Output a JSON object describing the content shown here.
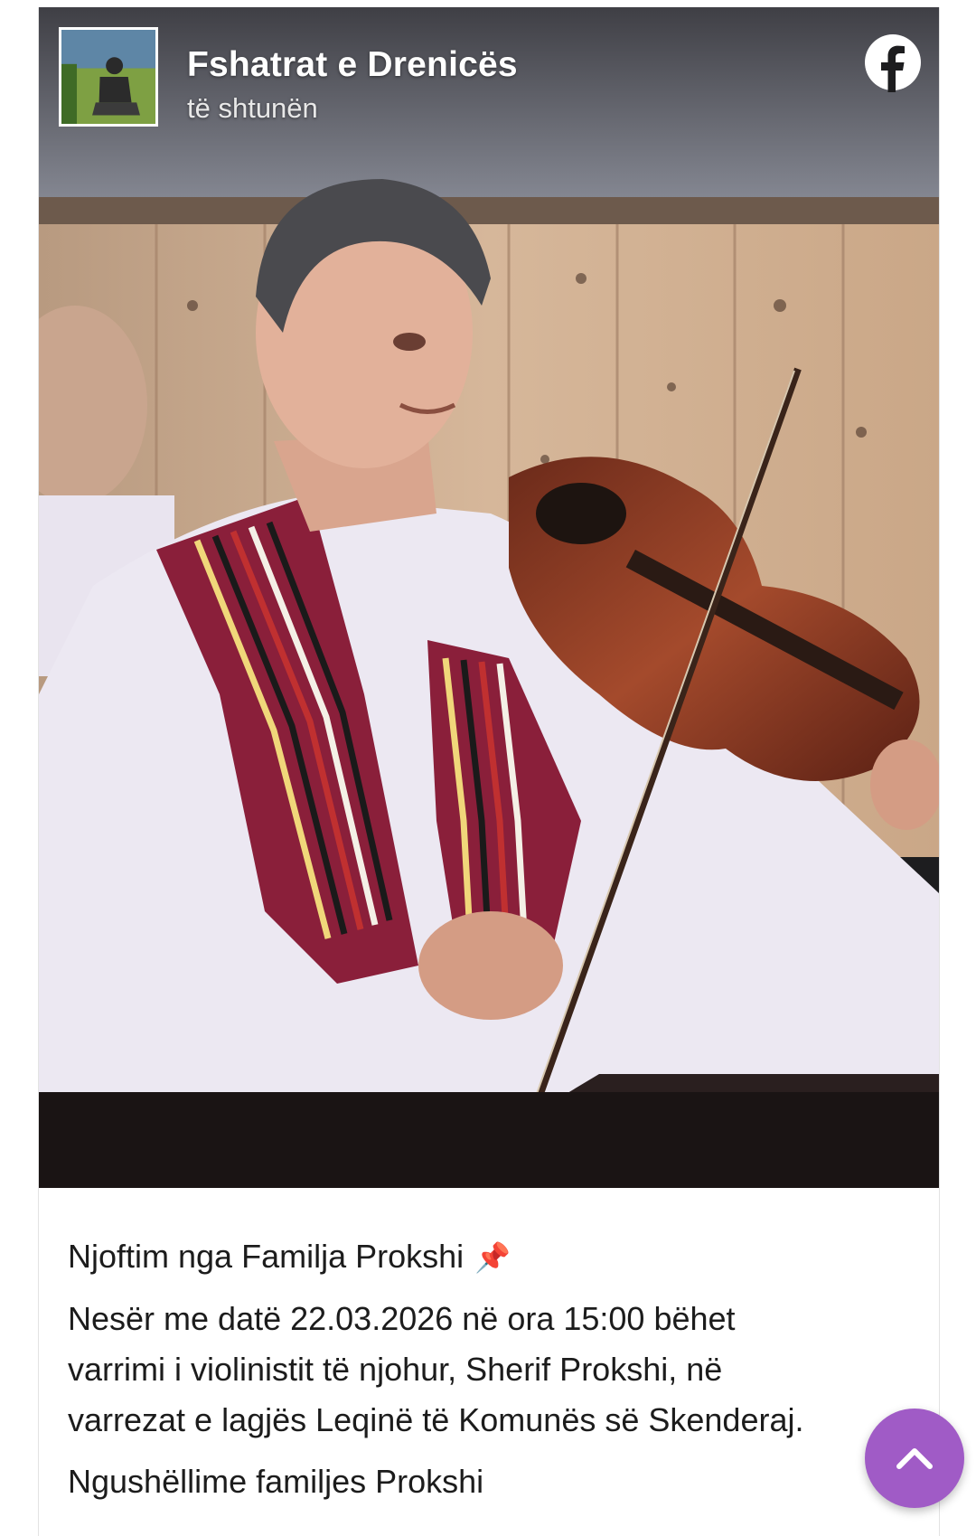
{
  "post": {
    "page_name": "Fshatrat e Drenicës",
    "time": "të shtunën",
    "avatar_icon": "page-avatar",
    "brand_icon": "facebook-logo-icon",
    "photo_subject": "",
    "announcement_title": "Njoftim nga Familja Prokshi",
    "pin_emoji": "📌",
    "body_lines": [
      "Nesër me datë 22.03.2026 në ora 15:00 bëhet",
      "varrimi i violinistit të njohur, Sherif Prokshi, në",
      "varrezat e lagjës Leqinë të Komunës së Skenderaj."
    ],
    "condolence": "Ngushëllime familjes Prokshi"
  },
  "controls": {
    "scroll_top_icon": "chevron-up-icon"
  },
  "colors": {
    "scroll_top_bg": "#a05bc6",
    "text": "#1c1c1c",
    "card_border": "#e3e3e3"
  }
}
